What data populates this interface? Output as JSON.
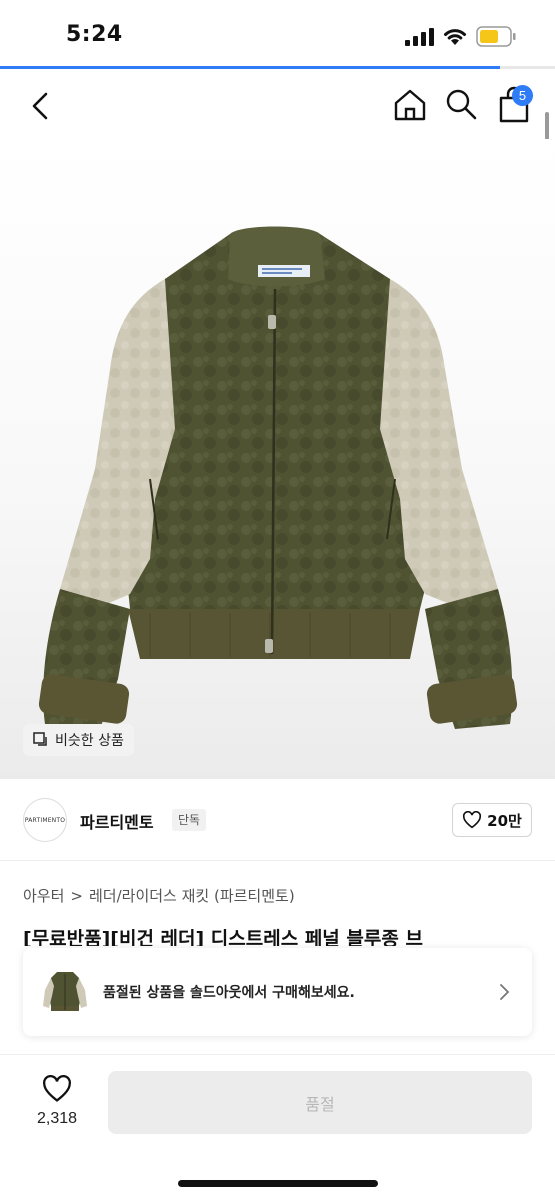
{
  "status_bar": {
    "time": "5:24",
    "icons": [
      "cellular-signal-icon",
      "wifi-icon",
      "battery-icon"
    ],
    "battery_color": "#f5c518"
  },
  "page_progress": {
    "fraction": 0.9,
    "color": "#2e7cf6"
  },
  "nav": {
    "icons": [
      "back-icon",
      "home-icon",
      "search-icon",
      "shopping-bag-icon"
    ],
    "cart_badge": "5"
  },
  "product_image": {
    "subject": "jacket",
    "similar_button_label": "비슷한 상품"
  },
  "seller": {
    "logo_text": "PARTIMENTO",
    "name": "파르티멘토",
    "exclusive_badge": "단독",
    "like_count": "20만"
  },
  "breadcrumb": {
    "category": "아우터",
    "separator": ">",
    "subcategory": "레더/라이더스 재킷 (파르티멘토)"
  },
  "product_title": "[무료반품][비건 레더] 디스트레스 페널 블루종 브",
  "soldout_banner": {
    "text": "품절된 상품을 솔드아웃에서 구매해보세요."
  },
  "bottom_bar": {
    "like_count": "2,318",
    "action_label": "품절"
  },
  "colors": {
    "accent": "#2e7cf6",
    "jacket_olive": "#4f5331",
    "jacket_beige": "#cfcab7"
  }
}
